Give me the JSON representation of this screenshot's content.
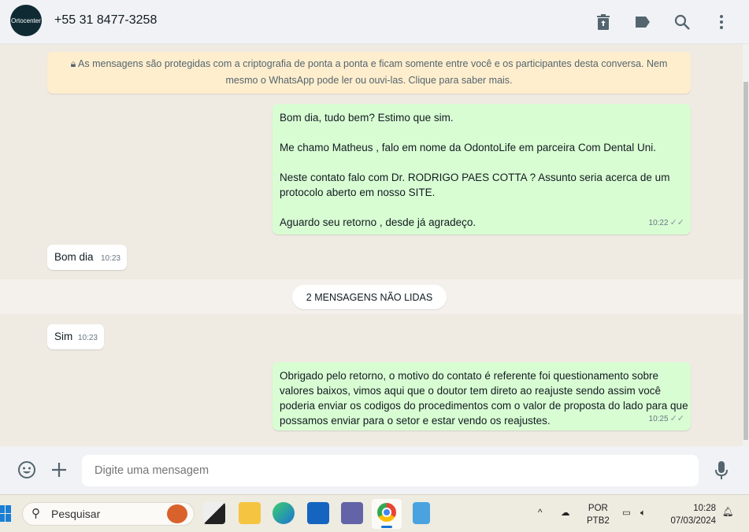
{
  "header": {
    "avatar_text": "Ortocenter",
    "contact": "+55 31 8477-3258",
    "icons": [
      "delete-upload-icon",
      "label-icon",
      "search-icon",
      "menu-icon"
    ]
  },
  "banner": {
    "text": "As mensagens são protegidas com a criptografia de ponta a ponta e ficam somente entre você e os participantes desta conversa. Nem mesmo o WhatsApp pode ler ou ouvi-las. Clique para saber mais."
  },
  "messages": [
    {
      "dir": "out",
      "lines": [
        "Bom dia, tudo bem? Estimo que sim.",
        "Me chamo Matheus , falo em nome da OdontoLife em parceira Com Dental Uni.",
        "Neste contato falo com Dr. RODRIGO PAES COTTA ? Assunto seria acerca de um protocolo aberto em nosso SITE.",
        "Aguardo seu retorno , desde já agradeço."
      ],
      "time": "10:22"
    },
    {
      "dir": "in",
      "text": "Bom dia",
      "time": "10:23"
    },
    {
      "dir": "in",
      "text": "Sim",
      "time": "10:23"
    },
    {
      "dir": "out",
      "text": "Obrigado pelo retorno, o motivo do contato é referente foi questionamento sobre valores baixos, vimos aqui que o doutor tem direto ao reajuste sendo assim você poderia enviar os codigos do procedimentos com o valor de proposta do lado para que possamos enviar para o setor e estar vendo os reajustes.",
      "time": "10:25"
    }
  ],
  "unread": "2 MENSAGENS NÃO LIDAS",
  "composer": {
    "placeholder": "Digite uma mensagem"
  },
  "taskbar": {
    "search": "Pesquisar",
    "lang1": "POR",
    "lang2": "PTB2",
    "time": "10:28",
    "date": "07/03/2024"
  }
}
